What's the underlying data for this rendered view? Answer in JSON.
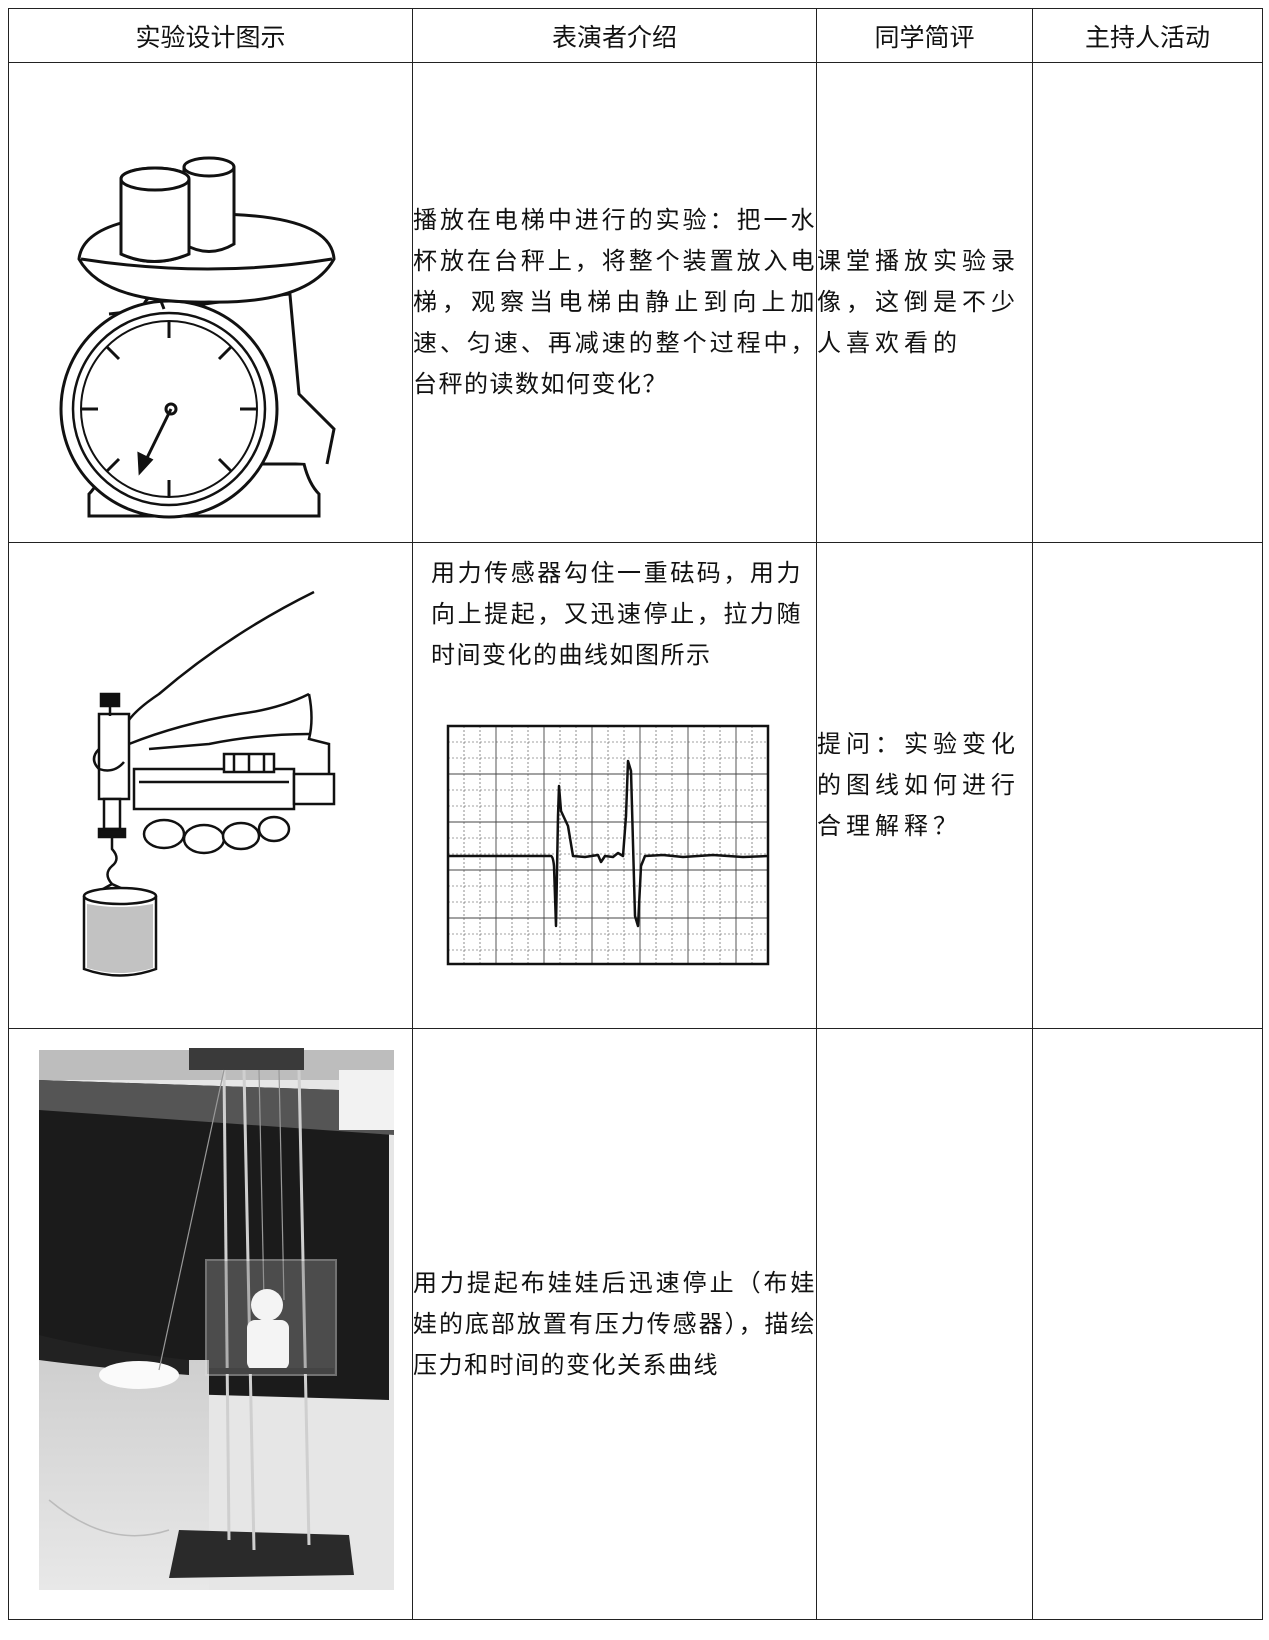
{
  "table": {
    "headers": [
      "实验设计图示",
      "表演者介绍",
      "同学简评",
      "主持人活动"
    ],
    "rows": [
      {
        "figure_icon": "dial-scale-with-cups-icon",
        "performer_intro": "播放在电梯中进行的实验：把一水杯放在台秤上，将整个装置放入电梯，观察当电梯由静止到向上加速、匀速、再减速的整个过程中，台秤的读数如何变化？",
        "student_comment": "课堂播放实验录像，这倒是不少人喜欢看的",
        "host_activity": ""
      },
      {
        "figure_icon": "hand-force-sensor-weight-icon",
        "performer_intro": "用力传感器勾住一重砝码，用力向上提起，又迅速停止，拉力随时间变化的曲线如图所示",
        "graph_icon": "force-time-curve-graph-icon",
        "student_comment": "提问：实验变化的图线如何进行合理解释？",
        "host_activity": ""
      },
      {
        "figure_icon": "doll-pressure-sensor-photo-icon",
        "performer_intro": "用力提起布娃娃后迅速停止（布娃娃的底部放置有压力传感器），描绘压力和时间的变化关系曲线",
        "student_comment": "",
        "host_activity": ""
      }
    ]
  }
}
